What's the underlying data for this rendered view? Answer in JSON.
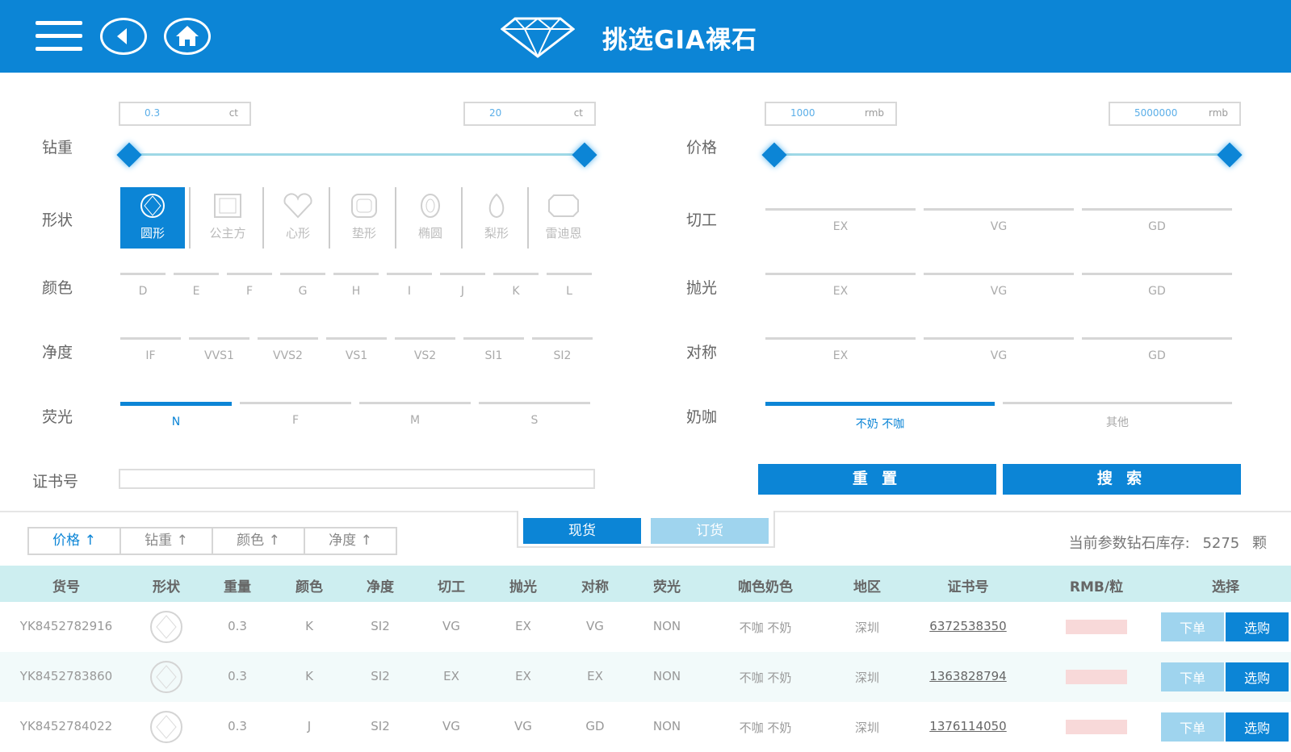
{
  "header": {
    "title": "挑选GIA裸石",
    "menu_icon": "hamburger-menu-icon",
    "back_icon": "back-arrow-icon",
    "home_icon": "home-icon",
    "logo_icon": "diamond-icon"
  },
  "filters": {
    "carat": {
      "label": "钻重",
      "min": "0.3",
      "max": "20",
      "unit": "ct"
    },
    "price": {
      "label": "价格",
      "min": "1000",
      "max": "5000000",
      "unit": "rmb"
    },
    "shape": {
      "label": "形状",
      "options": [
        {
          "label": "圆形",
          "icon": "round-diamond-icon",
          "selected": true
        },
        {
          "label": "公主方",
          "icon": "princess-diamond-icon",
          "selected": false
        },
        {
          "label": "心形",
          "icon": "heart-diamond-icon",
          "selected": false
        },
        {
          "label": "垫形",
          "icon": "cushion-diamond-icon",
          "selected": false
        },
        {
          "label": "椭圆",
          "icon": "oval-diamond-icon",
          "selected": false
        },
        {
          "label": "梨形",
          "icon": "pear-diamond-icon",
          "selected": false
        },
        {
          "label": "雷迪恩",
          "icon": "radiant-diamond-icon",
          "selected": false
        }
      ]
    },
    "color": {
      "label": "颜色",
      "options": [
        "D",
        "E",
        "F",
        "G",
        "H",
        "I",
        "J",
        "K",
        "L"
      ]
    },
    "clarity": {
      "label": "净度",
      "options": [
        "IF",
        "VVS1",
        "VVS2",
        "VS1",
        "VS2",
        "SI1",
        "SI2"
      ]
    },
    "fluorescence": {
      "label": "荧光",
      "options": [
        "N",
        "F",
        "M",
        "S"
      ],
      "selected": "N"
    },
    "cut": {
      "label": "切工",
      "options": [
        "EX",
        "VG",
        "GD"
      ]
    },
    "polish": {
      "label": "抛光",
      "options": [
        "EX",
        "VG",
        "GD"
      ]
    },
    "symmetry": {
      "label": "对称",
      "options": [
        "EX",
        "VG",
        "GD"
      ]
    },
    "milky": {
      "label": "奶咖",
      "options": [
        "不奶 不咖",
        "其他"
      ],
      "selected": "不奶 不咖"
    },
    "certificate": {
      "label": "证书号",
      "value": ""
    },
    "reset_label": "重 置",
    "search_label": "搜 索"
  },
  "sort": {
    "buttons": [
      "价格 ↑",
      "钻重 ↑",
      "颜色 ↑",
      "净度 ↑"
    ],
    "active": 0
  },
  "tabs": {
    "spot": "现货",
    "order": "订货"
  },
  "stock": {
    "prefix": "当前参数钻石库存:",
    "count": "5275",
    "suffix": "颗"
  },
  "table": {
    "headers": [
      "货号",
      "形状",
      "重量",
      "颜色",
      "净度",
      "切工",
      "抛光",
      "对称",
      "荧光",
      "咖色奶色",
      "地区",
      "证书号",
      "RMB/粒",
      "选择"
    ],
    "rows": [
      {
        "id": "YK8452782916",
        "weight": "0.3",
        "color": "K",
        "clarity": "SI2",
        "cut": "VG",
        "polish": "EX",
        "symmetry": "VG",
        "fluor": "NON",
        "milky": "不咖 不奶",
        "region": "深圳",
        "cert": "6372538350"
      },
      {
        "id": "YK8452783860",
        "weight": "0.3",
        "color": "K",
        "clarity": "SI2",
        "cut": "EX",
        "polish": "EX",
        "symmetry": "EX",
        "fluor": "NON",
        "milky": "不咖 不奶",
        "region": "深圳",
        "cert": "1363828794"
      },
      {
        "id": "YK8452784022",
        "weight": "0.3",
        "color": "J",
        "clarity": "SI2",
        "cut": "VG",
        "polish": "VG",
        "symmetry": "GD",
        "fluor": "NON",
        "milky": "不咖 不奶",
        "region": "深圳",
        "cert": "1376114050"
      }
    ],
    "order_label": "下单",
    "pick_label": "选购"
  },
  "colors": {
    "primary": "#0c85d6",
    "header_row": "#cdeef0",
    "light_button": "#9fd4ee"
  }
}
